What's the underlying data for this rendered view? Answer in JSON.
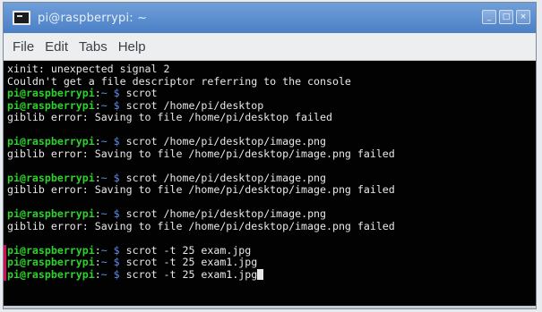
{
  "window": {
    "title": "pi@raspberrypi: ~",
    "buttons": [
      "_",
      "□",
      "×"
    ]
  },
  "menu": [
    "File",
    "Edit",
    "Tabs",
    "Help"
  ],
  "prompt": {
    "user_host": "pi@raspberrypi",
    "sep": ":",
    "path": "~ $",
    "space": " "
  },
  "lines": [
    {
      "type": "out",
      "text": "xinit: unexpected signal 2"
    },
    {
      "type": "out",
      "text": "Couldn't get a file descriptor referring to the console"
    },
    {
      "type": "cmd",
      "text": "scrot"
    },
    {
      "type": "cmd",
      "text": "scrot /home/pi/desktop"
    },
    {
      "type": "out",
      "text": "giblib error: Saving to file /home/pi/desktop failed"
    },
    {
      "type": "blank",
      "text": ""
    },
    {
      "type": "cmd",
      "text": "scrot /home/pi/desktop/image.png"
    },
    {
      "type": "out",
      "text": "giblib error: Saving to file /home/pi/desktop/image.png failed"
    },
    {
      "type": "blank",
      "text": ""
    },
    {
      "type": "cmd",
      "text": "scrot /home/pi/desktop/image.png"
    },
    {
      "type": "out",
      "text": "giblib error: Saving to file /home/pi/desktop/image.png failed"
    },
    {
      "type": "blank",
      "text": ""
    },
    {
      "type": "cmd",
      "text": "scrot /home/pi/desktop/image.png"
    },
    {
      "type": "out",
      "text": "giblib error: Saving to file /home/pi/desktop/image.png failed"
    },
    {
      "type": "blank",
      "text": ""
    },
    {
      "type": "cmd",
      "text": "scrot -t 25 exam.jpg"
    },
    {
      "type": "cmd",
      "text": "scrot -t 25 exam1.jpg"
    },
    {
      "type": "cmd",
      "text": "scrot -t 25 exam1.jpg",
      "cursor": true
    }
  ],
  "colors": {
    "prompt_user": "#2fd12f",
    "prompt_path": "#5d8df0",
    "titlebar": "#4b80c6",
    "terminal_bg": "#020202"
  }
}
